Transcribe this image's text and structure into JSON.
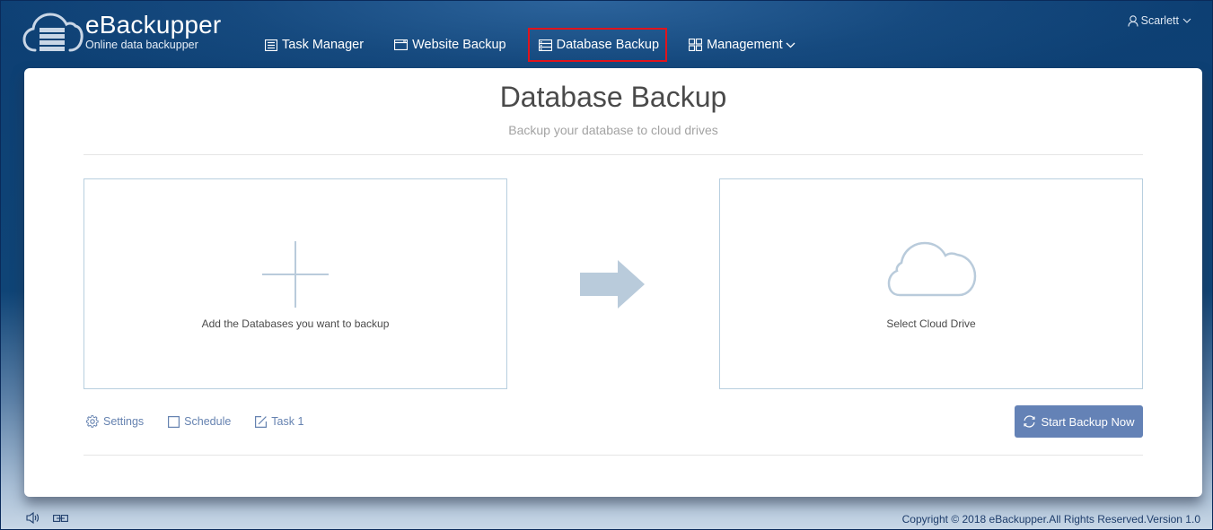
{
  "app": {
    "name": "eBackupper",
    "tagline": "Online data backupper"
  },
  "nav": {
    "items": [
      {
        "label": "Task Manager",
        "icon": "list-icon",
        "active": false
      },
      {
        "label": "Website Backup",
        "icon": "browser-window-icon",
        "active": false
      },
      {
        "label": "Database Backup",
        "icon": "database-icon",
        "active": true
      },
      {
        "label": "Management",
        "icon": "grid-icon",
        "active": false,
        "dropdown": true
      }
    ]
  },
  "user": {
    "name": "Scarlett",
    "icon": "user-icon"
  },
  "main": {
    "title": "Database Backup",
    "subtitle": "Backup your database to cloud drives",
    "source_panel": {
      "label": "Add the Databases you want to backup",
      "icon": "plus-icon"
    },
    "destination_panel": {
      "label": "Select Cloud Drive",
      "icon": "cloud-icon"
    },
    "links": {
      "settings": "Settings",
      "schedule": "Schedule",
      "task_name": "Task 1"
    },
    "start_button": "Start Backup Now"
  },
  "footer": {
    "copyright": "Copyright © 2018 eBackupper.All Rights Reserved.Version 1.0",
    "icons": [
      "speaker-icon",
      "link-icon"
    ]
  },
  "colors": {
    "header_bg": "#0d3f73",
    "active_outline": "#e0141c",
    "accent_button": "#6482b6",
    "link_color": "#6582b0",
    "panel_border": "#b8cfdf",
    "icon_light_blue": "#b9cbdb"
  }
}
